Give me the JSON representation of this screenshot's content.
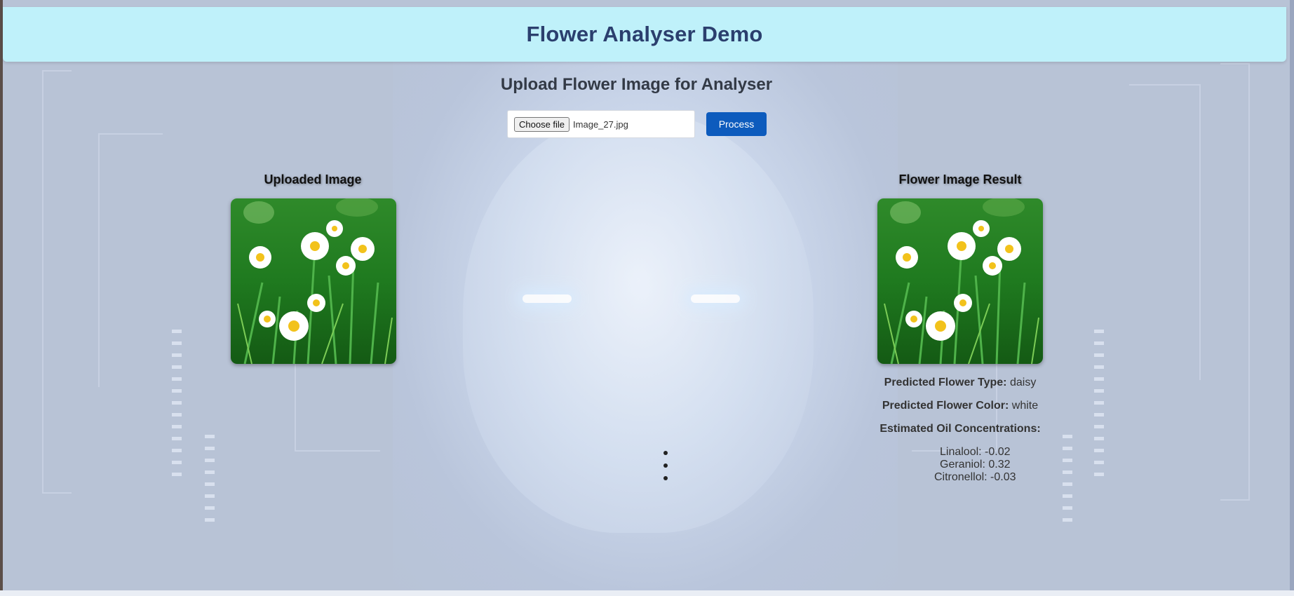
{
  "header": {
    "title": "Flower Analyser Demo"
  },
  "upload": {
    "title": "Upload Flower Image for Analyser",
    "choose_label": "Choose file",
    "file_name": "Image_27.jpg",
    "process_label": "Process"
  },
  "uploaded": {
    "title": "Uploaded Image"
  },
  "result": {
    "title": "Flower Image Result",
    "type_label": "Predicted Flower Type:",
    "type_value": "daisy",
    "color_label": "Predicted Flower Color:",
    "color_value": "white",
    "oil_label": "Estimated Oil Concentrations:",
    "oils": [
      {
        "text": "Linalool: -0.02"
      },
      {
        "text": "Geraniol: 0.32"
      },
      {
        "text": "Citronellol: -0.03"
      }
    ]
  }
}
